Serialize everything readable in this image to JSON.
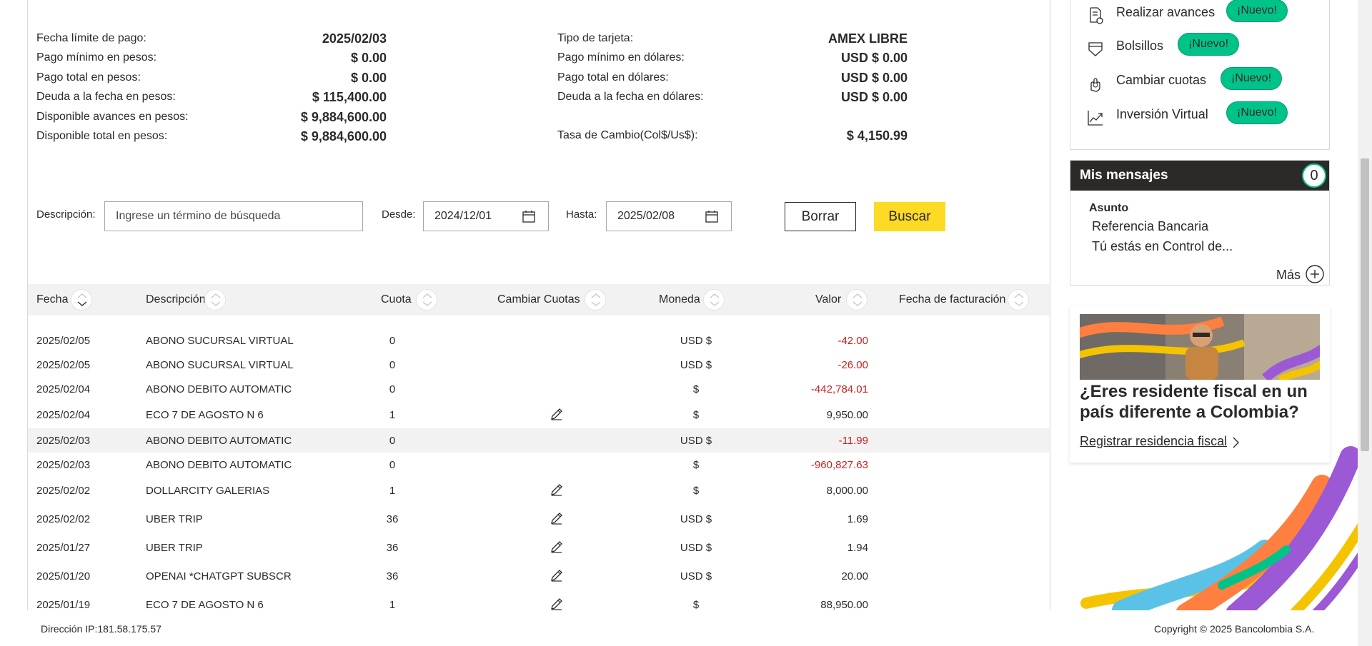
{
  "summary": {
    "left": [
      {
        "label": "Fecha límite de pago:",
        "value": "2025/02/03"
      },
      {
        "label": "Pago mínimo en pesos:",
        "value": "$ 0.00"
      },
      {
        "label": "Pago total en pesos:",
        "value": "$ 0.00"
      },
      {
        "label": "Deuda a la fecha en pesos:",
        "value": "$ 115,400.00"
      },
      {
        "label": "Disponible avances en pesos:",
        "value": "$ 9,884,600.00"
      },
      {
        "label": "Disponible total en pesos:",
        "value": "$ 9,884,600.00"
      }
    ],
    "right": [
      {
        "label": "Tipo de tarjeta:",
        "value": "AMEX LIBRE"
      },
      {
        "label": "Pago mínimo en dólares:",
        "value": "USD $ 0.00"
      },
      {
        "label": "Pago total en dólares:",
        "value": "USD $ 0.00"
      },
      {
        "label": "Deuda a la fecha en dólares:",
        "value": "USD $ 0.00"
      },
      {
        "label": "Tasa de Cambio(Col$/Us$):",
        "value": "$ 4,150.99"
      }
    ]
  },
  "filters": {
    "descripcion_label": "Descripción:",
    "descripcion_placeholder": "Ingrese un término de búsqueda",
    "desde_label": "Desde:",
    "desde_value": "2024/12/01",
    "hasta_label": "Hasta:",
    "hasta_value": "2025/02/08",
    "borrar_label": "Borrar",
    "buscar_label": "Buscar"
  },
  "table": {
    "headers": [
      "Fecha",
      "Descripción",
      "Cuota",
      "Cambiar Cuotas",
      "Moneda",
      "Valor",
      "Fecha de facturación"
    ],
    "rows": [
      {
        "fecha": "2025/02/05",
        "descripcion": "ABONO SUCURSAL VIRTUAL",
        "cuota": "0",
        "editable": false,
        "moneda": "USD $",
        "valor": "-42.00",
        "negative": true
      },
      {
        "fecha": "2025/02/05",
        "descripcion": "ABONO SUCURSAL VIRTUAL",
        "cuota": "0",
        "editable": false,
        "moneda": "USD $",
        "valor": "-26.00",
        "negative": true
      },
      {
        "fecha": "2025/02/04",
        "descripcion": "ABONO DEBITO AUTOMATIC",
        "cuota": "0",
        "editable": false,
        "moneda": "$",
        "valor": "-442,784.01",
        "negative": true
      },
      {
        "fecha": "2025/02/04",
        "descripcion": "ECO 7 DE AGOSTO N 6",
        "cuota": "1",
        "editable": true,
        "moneda": "$",
        "valor": "9,950.00",
        "negative": false
      },
      {
        "fecha": "2025/02/03",
        "descripcion": "ABONO DEBITO AUTOMATIC",
        "cuota": "0",
        "editable": false,
        "moneda": "USD $",
        "valor": "-11.99",
        "negative": true,
        "highlighted": true
      },
      {
        "fecha": "2025/02/03",
        "descripcion": "ABONO DEBITO AUTOMATIC",
        "cuota": "0",
        "editable": false,
        "moneda": "$",
        "valor": "-960,827.63",
        "negative": true
      },
      {
        "fecha": "2025/02/02",
        "descripcion": "DOLLARCITY GALERIAS",
        "cuota": "1",
        "editable": true,
        "moneda": "$",
        "valor": "8,000.00",
        "negative": false
      },
      {
        "fecha": "2025/02/02",
        "descripcion": "UBER TRIP",
        "cuota": "36",
        "editable": true,
        "moneda": "USD $",
        "valor": "1.69",
        "negative": false
      },
      {
        "fecha": "2025/01/27",
        "descripcion": "UBER TRIP",
        "cuota": "36",
        "editable": true,
        "moneda": "USD $",
        "valor": "1.94",
        "negative": false
      },
      {
        "fecha": "2025/01/20",
        "descripcion": "OPENAI *CHATGPT SUBSCR",
        "cuota": "36",
        "editable": true,
        "moneda": "USD $",
        "valor": "20.00",
        "negative": false
      },
      {
        "fecha": "2025/01/19",
        "descripcion": "ECO 7 DE AGOSTO N 6",
        "cuota": "1",
        "editable": true,
        "moneda": "$",
        "valor": "88,950.00",
        "negative": false
      }
    ]
  },
  "options": [
    {
      "label": "Realizar avances",
      "badge": "¡Nuevo!",
      "icon": "document-cash-icon"
    },
    {
      "label": "Bolsillos",
      "badge": "¡Nuevo!",
      "icon": "pocket-icon"
    },
    {
      "label": "Cambiar cuotas",
      "badge": "¡Nuevo!",
      "icon": "coins-hand-icon"
    },
    {
      "label": "Inversión Virtual",
      "badge": "¡Nuevo!",
      "icon": "chart-growth-icon"
    }
  ],
  "messages": {
    "title": "Mis mensajes",
    "count": "0",
    "asunto_label": "Asunto",
    "items": [
      "Referencia Bancaria",
      "Tú estás en Control de..."
    ],
    "more_label": "Más"
  },
  "promo": {
    "title": "¿Eres residente fiscal en un país diferente a Colombia?",
    "link": "Registrar residencia fiscal"
  },
  "footer": {
    "ip": "Dirección IP:181.58.175.57",
    "copyright": "Copyright © 2025 Bancolombia S.A."
  },
  "colors": {
    "accent_yellow": "#fdda24",
    "badge_green": "#00c389",
    "negative_red": "#cc1f1f",
    "dark": "#2c2a29"
  }
}
